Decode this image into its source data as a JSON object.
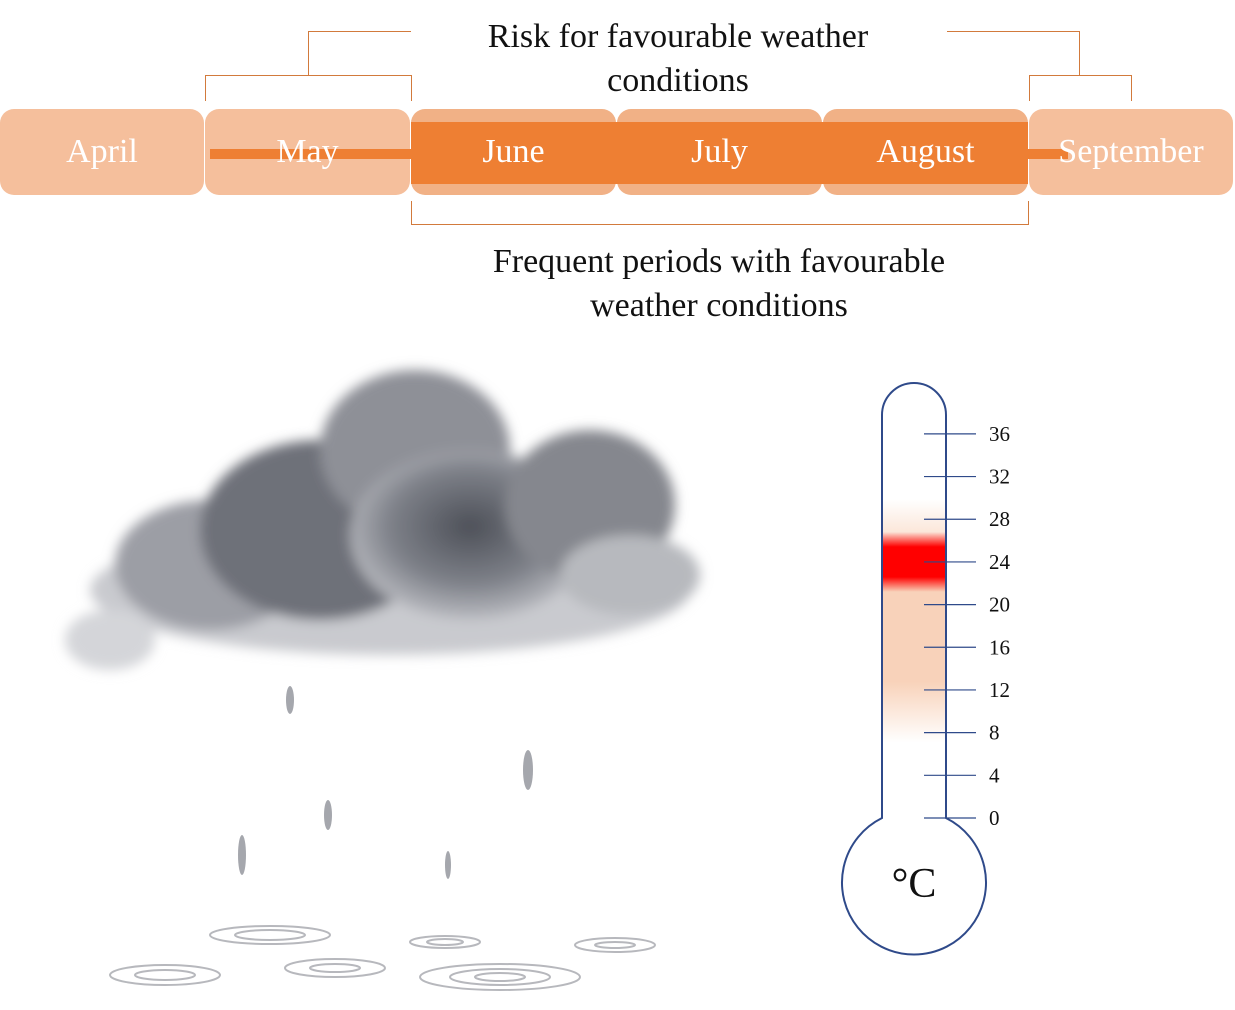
{
  "timeline": {
    "months": [
      "April",
      "May",
      "June",
      "July",
      "August",
      "September"
    ],
    "risk_caption": [
      "Risk for favourable weather",
      "conditions"
    ],
    "frequent_caption": [
      "Frequent periods with favourable",
      "weather conditions"
    ]
  },
  "thermometer": {
    "unit": "°C",
    "ticks": [
      "36",
      "32",
      "28",
      "24",
      "20",
      "16",
      "12",
      "8",
      "4",
      "0"
    ],
    "favourable_range": [
      8,
      28
    ],
    "optimal_value": 24
  },
  "colors": {
    "month_bg": "#f5bf9c",
    "core_band": "#ee7f33",
    "optimal_band": "#ff0000",
    "thermometer_outline": "#2f4a8a"
  }
}
